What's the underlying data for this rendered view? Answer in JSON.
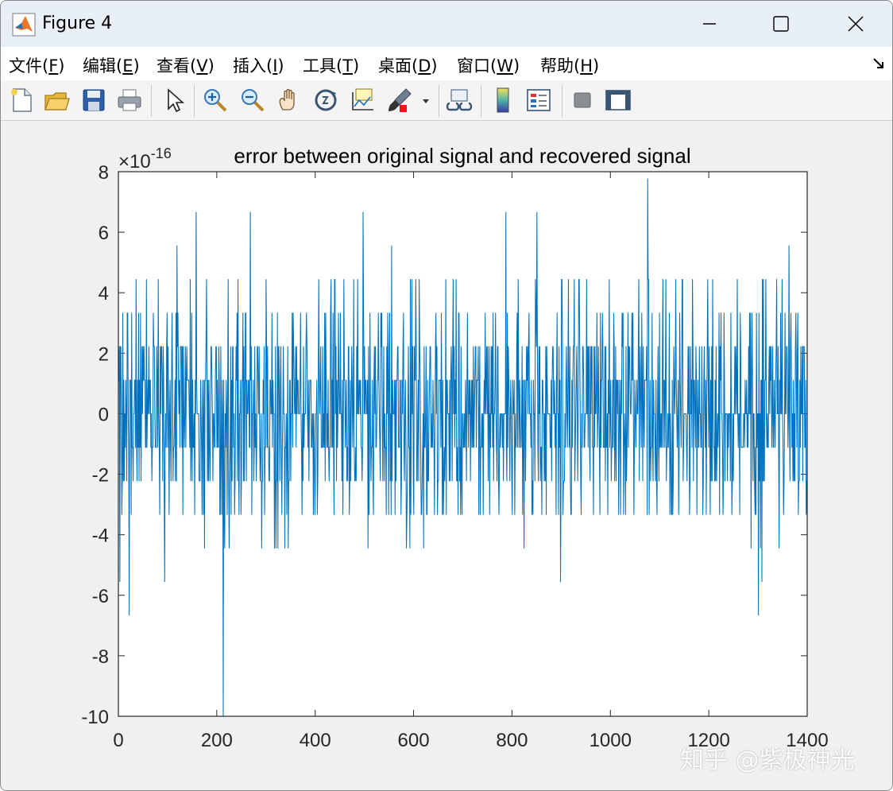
{
  "window": {
    "title": "Figure 4",
    "controls": {
      "minimize": "—",
      "maximize": "☐",
      "close": "✕"
    }
  },
  "menubar": {
    "items": [
      {
        "label": "文件(",
        "key": "F",
        "end": ")"
      },
      {
        "label": "编辑(",
        "key": "E",
        "end": ")"
      },
      {
        "label": "查看(",
        "key": "V",
        "end": ")"
      },
      {
        "label": "插入(",
        "key": "I",
        "end": ")"
      },
      {
        "label": "工具(",
        "key": "T",
        "end": ")"
      },
      {
        "label": "桌面(",
        "key": "D",
        "end": ")"
      },
      {
        "label": "窗口(",
        "key": "W",
        "end": ")"
      },
      {
        "label": "帮助(",
        "key": "H",
        "end": ")"
      }
    ],
    "undock_icon": "undock-arrow-icon"
  },
  "toolbar": {
    "icons": [
      "new-figure-icon",
      "open-file-icon",
      "save-icon",
      "print-icon",
      "pointer-icon",
      "zoom-in-icon",
      "zoom-out-icon",
      "pan-icon",
      "rotate-3d-icon",
      "data-cursor-icon",
      "brush-icon",
      "link-plot-icon",
      "colorbar-icon",
      "legend-icon",
      "hide-plot-tools-icon",
      "show-plot-tools-icon"
    ]
  },
  "chart_data": {
    "type": "line",
    "title": "error between original signal and recovered signal",
    "exponent_label": "×10",
    "exponent_power": "-16",
    "xlabel": "",
    "ylabel": "",
    "xlim": [
      0,
      1400
    ],
    "ylim": [
      -10,
      8
    ],
    "x_ticks": [
      0,
      200,
      400,
      600,
      800,
      1000,
      1200,
      1400
    ],
    "y_ticks": [
      -10,
      -8,
      -6,
      -4,
      -2,
      0,
      2,
      4,
      6,
      8
    ],
    "line_color": "#0072BD",
    "n_points": 1400,
    "quantization_step": 1.11,
    "series": [
      {
        "values_note_levels": [
          -9.99,
          -6.66,
          -5.55,
          -4.44,
          -3.33,
          -2.22,
          -1.11,
          0,
          1.11,
          2.22,
          3.33,
          4.44,
          5.55,
          6.66,
          7.77
        ],
        "notable_points": [
          {
            "x": 0,
            "y": 2.22
          },
          {
            "x": 22,
            "y": -6.66
          },
          {
            "x": 158,
            "y": 6.66
          },
          {
            "x": 213,
            "y": -9.99
          },
          {
            "x": 268,
            "y": 6.66
          },
          {
            "x": 497,
            "y": 6.66
          },
          {
            "x": 787,
            "y": 6.66
          },
          {
            "x": 850,
            "y": 6.66
          },
          {
            "x": 1075,
            "y": 7.77
          },
          {
            "x": 1300,
            "y": -6.66
          },
          {
            "x": 1400,
            "y": -3.33
          }
        ]
      }
    ]
  },
  "watermark": "知乎 @紫极神光"
}
